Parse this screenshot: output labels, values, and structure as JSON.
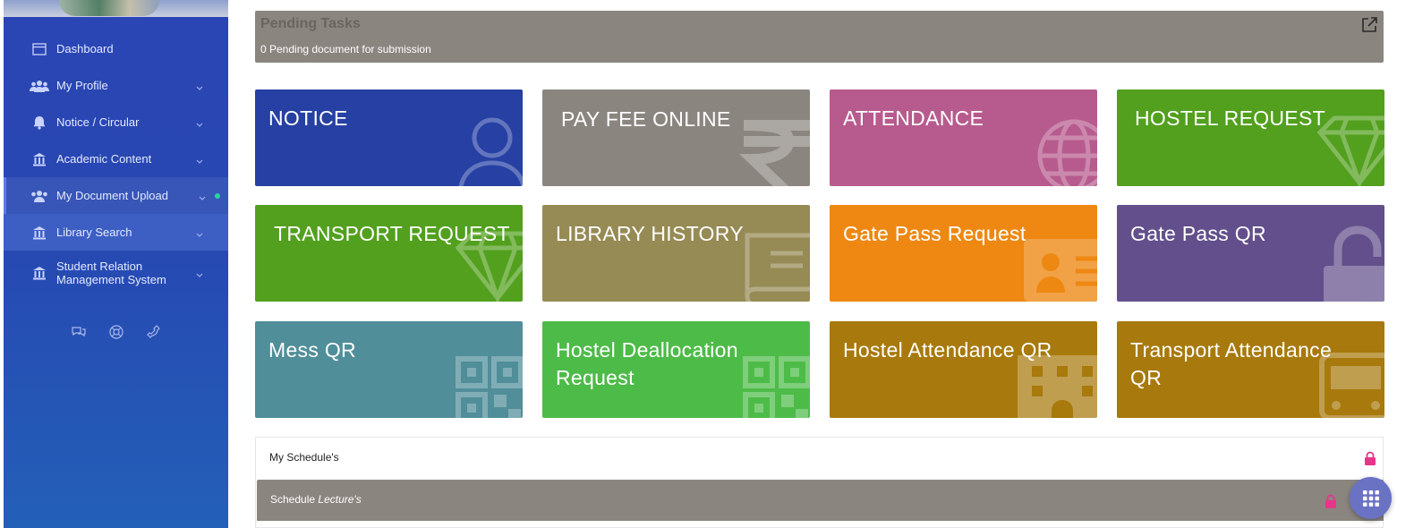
{
  "sidebar": {
    "items": [
      {
        "label": "Dashboard"
      },
      {
        "label": "My Profile"
      },
      {
        "label": "Notice / Circular"
      },
      {
        "label": "Academic Content"
      },
      {
        "label": "My Document Upload"
      },
      {
        "label": "Library Search"
      },
      {
        "label": "Student Relation Management System"
      }
    ]
  },
  "pending": {
    "title": "Pending Tasks",
    "subtitle": "0 Pending document for submission"
  },
  "tiles": [
    {
      "label": "NOTICE",
      "color": "#2640a4",
      "icon": "user-icon"
    },
    {
      "label": "PAY FEE ONLINE",
      "color": "#8b8580",
      "icon": "rupee-icon"
    },
    {
      "label": "ATTENDANCE",
      "color": "#b75b8e",
      "icon": "globe-icon"
    },
    {
      "label": "HOSTEL REQUEST",
      "color": "#52a01e",
      "icon": "diamond-icon"
    },
    {
      "label": "TRANSPORT REQUEST",
      "color": "#52a01e",
      "icon": "diamond-icon"
    },
    {
      "label": "LIBRARY HISTORY",
      "color": "#968a55",
      "icon": "book-icon"
    },
    {
      "label": "Gate Pass Request",
      "color": "#ee8812",
      "icon": "id-card-icon"
    },
    {
      "label": "Gate Pass QR",
      "color": "#624f8b",
      "icon": "unlock-icon"
    },
    {
      "label": "Mess QR",
      "color": "#508e99",
      "icon": "qr-icon"
    },
    {
      "label": "Hostel Deallocation Request",
      "color": "#4dbb48",
      "icon": "qr-icon"
    },
    {
      "label": "Hostel Attendance QR",
      "color": "#a8790c",
      "icon": "building-icon"
    },
    {
      "label": "Transport Attendance QR",
      "color": "#a8790c",
      "icon": "bus-icon"
    }
  ],
  "schedules": {
    "title": "My Schedule's",
    "lecture_prefix": "Schedule",
    "lecture_italic": "Lecture's"
  },
  "colors": {
    "sidebar": "#2748b2",
    "accent_dot": "#2ad4a0",
    "lock": "#e8348a",
    "fab": "#6a72c4"
  }
}
